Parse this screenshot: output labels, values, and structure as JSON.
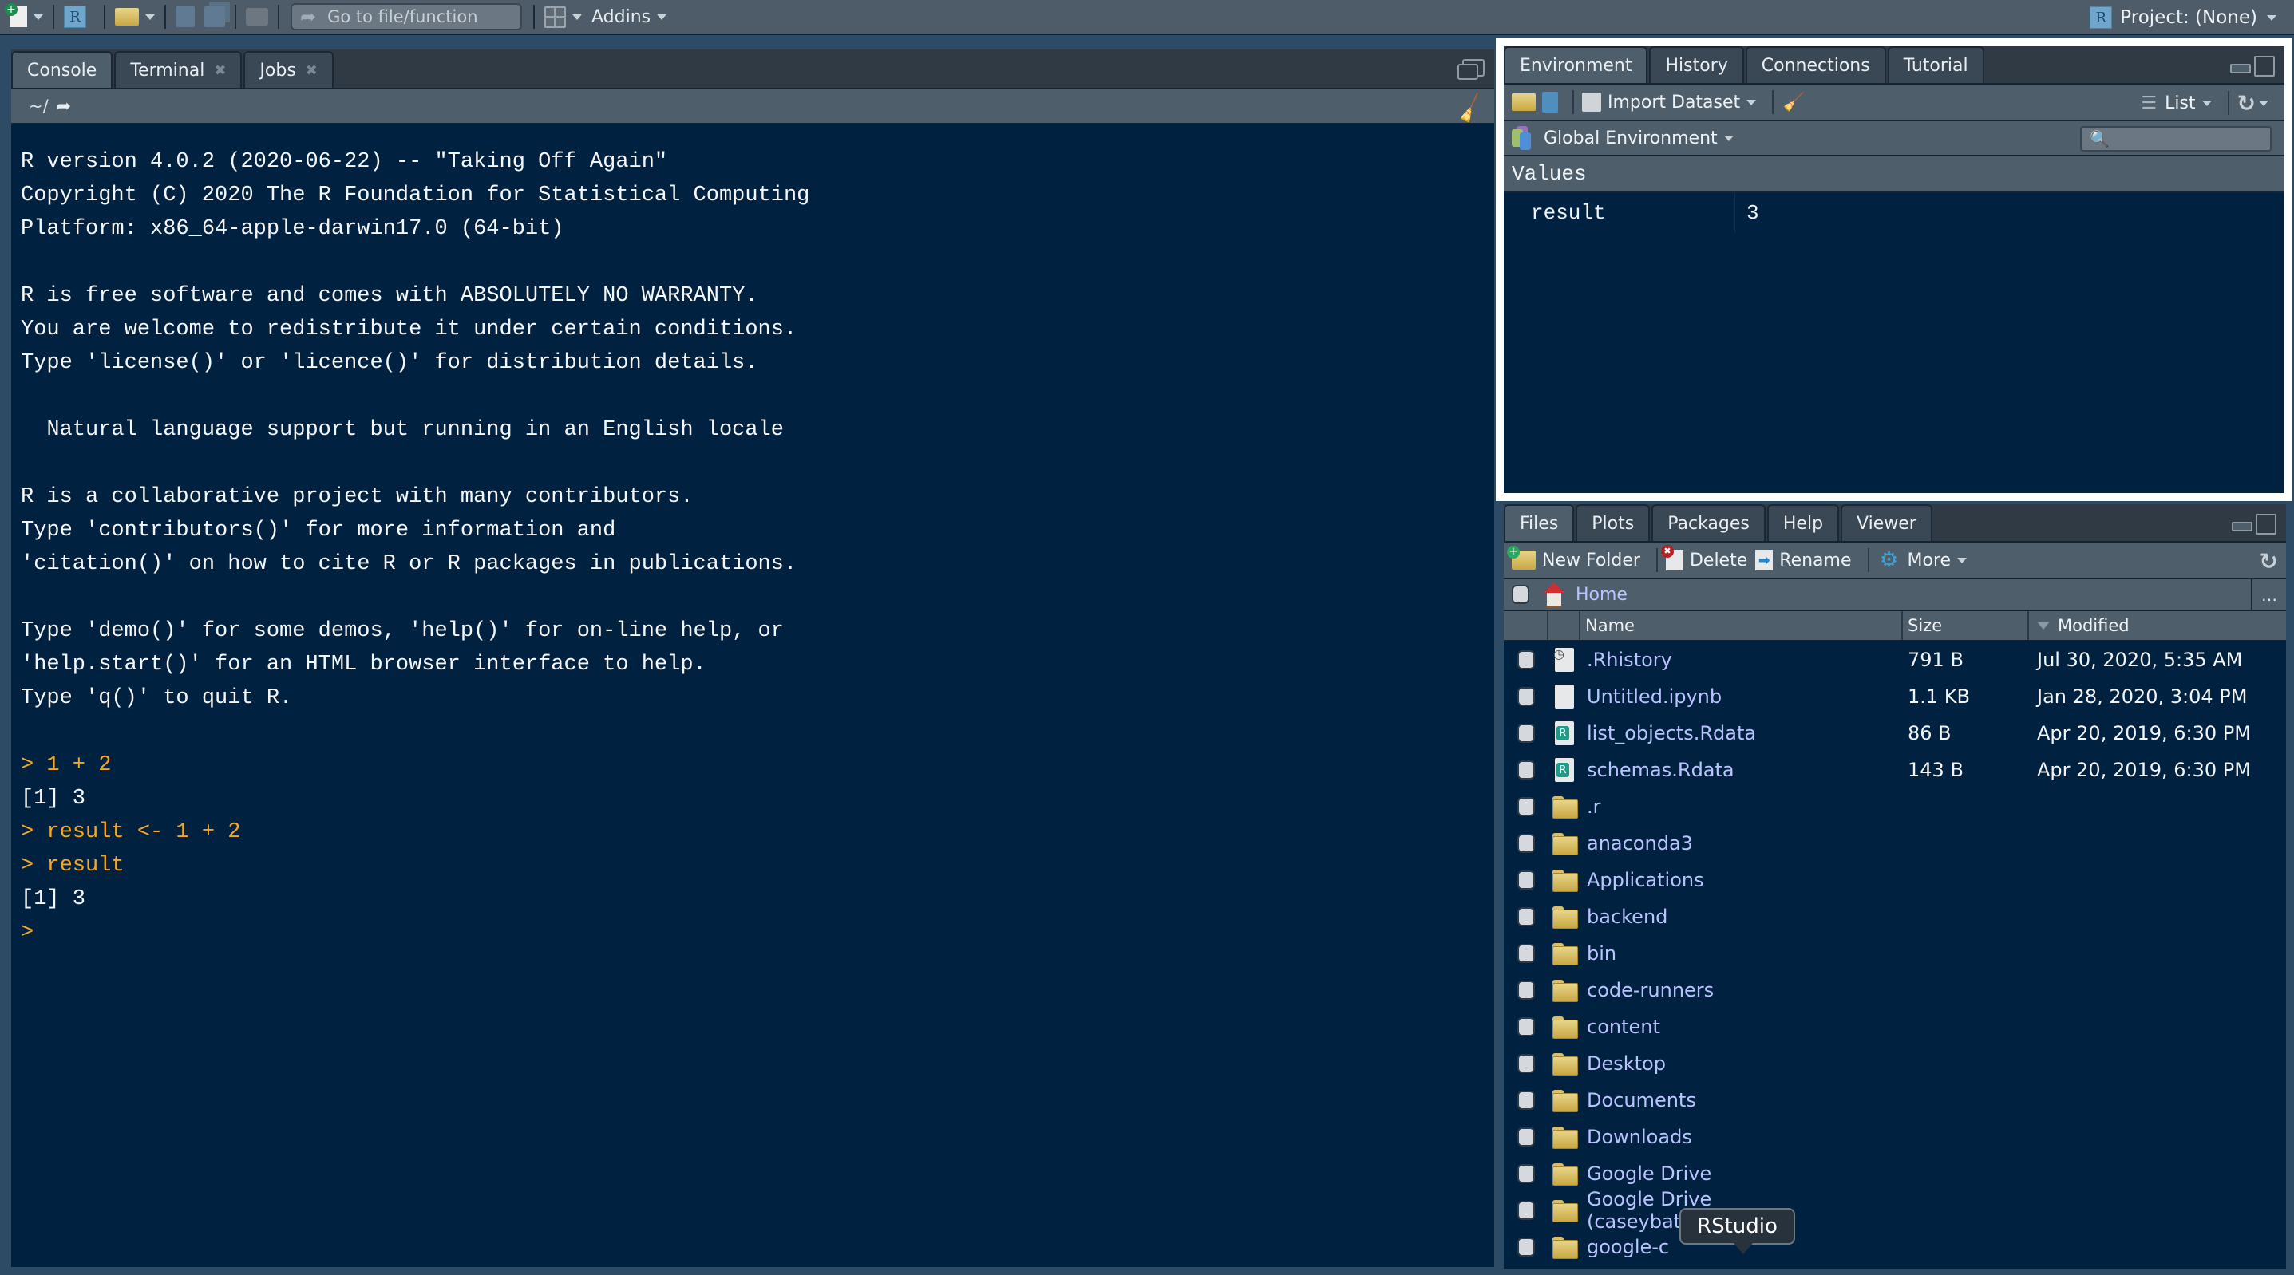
{
  "toolbar": {
    "goto_placeholder": "Go to file/function",
    "addins_label": "Addins",
    "project_label": "Project: (None)"
  },
  "left_pane": {
    "tabs": [
      {
        "label": "Console",
        "closable": false,
        "active": true
      },
      {
        "label": "Terminal",
        "closable": true,
        "active": false
      },
      {
        "label": "Jobs",
        "closable": true,
        "active": false
      }
    ],
    "working_dir": "~/",
    "console_lines": [
      {
        "text": "R version 4.0.2 (2020-06-22) -- \"Taking Off Again\"",
        "type": "output"
      },
      {
        "text": "Copyright (C) 2020 The R Foundation for Statistical Computing",
        "type": "output"
      },
      {
        "text": "Platform: x86_64-apple-darwin17.0 (64-bit)",
        "type": "output"
      },
      {
        "text": "",
        "type": "output"
      },
      {
        "text": "R is free software and comes with ABSOLUTELY NO WARRANTY.",
        "type": "output"
      },
      {
        "text": "You are welcome to redistribute it under certain conditions.",
        "type": "output"
      },
      {
        "text": "Type 'license()' or 'licence()' for distribution details.",
        "type": "output"
      },
      {
        "text": "",
        "type": "output"
      },
      {
        "text": "  Natural language support but running in an English locale",
        "type": "output"
      },
      {
        "text": "",
        "type": "output"
      },
      {
        "text": "R is a collaborative project with many contributors.",
        "type": "output"
      },
      {
        "text": "Type 'contributors()' for more information and",
        "type": "output"
      },
      {
        "text": "'citation()' on how to cite R or R packages in publications.",
        "type": "output"
      },
      {
        "text": "",
        "type": "output"
      },
      {
        "text": "Type 'demo()' for some demos, 'help()' for on-line help, or",
        "type": "output"
      },
      {
        "text": "'help.start()' for an HTML browser interface to help.",
        "type": "output"
      },
      {
        "text": "Type 'q()' to quit R.",
        "type": "output"
      },
      {
        "text": "",
        "type": "output"
      },
      {
        "text": "> 1 + 2",
        "type": "cmd"
      },
      {
        "text": "[1] 3",
        "type": "output"
      },
      {
        "text": "> result <- 1 + 2",
        "type": "cmd"
      },
      {
        "text": "> result",
        "type": "cmd"
      },
      {
        "text": "[1] 3",
        "type": "output"
      },
      {
        "text": ">",
        "type": "cmd"
      }
    ]
  },
  "env_pane": {
    "tabs": [
      {
        "label": "Environment",
        "active": true
      },
      {
        "label": "History",
        "active": false
      },
      {
        "label": "Connections",
        "active": false
      },
      {
        "label": "Tutorial",
        "active": false
      }
    ],
    "import_label": "Import Dataset",
    "view_mode": "List",
    "environment": "Global Environment",
    "search_placeholder": "",
    "section_header": "Values",
    "values": [
      {
        "name": "result",
        "value": "3"
      }
    ]
  },
  "files_pane": {
    "tabs": [
      {
        "label": "Files",
        "active": true
      },
      {
        "label": "Plots",
        "active": false
      },
      {
        "label": "Packages",
        "active": false
      },
      {
        "label": "Help",
        "active": false
      },
      {
        "label": "Viewer",
        "active": false
      }
    ],
    "new_folder_label": "New Folder",
    "delete_label": "Delete",
    "rename_label": "Rename",
    "more_label": "More",
    "path": "Home",
    "columns": {
      "name": "Name",
      "size": "Size",
      "modified": "Modified"
    },
    "files": [
      {
        "name": ".Rhistory",
        "size": "791 B",
        "modified": "Jul 30, 2020, 5:35 AM",
        "kind": "hist"
      },
      {
        "name": "Untitled.ipynb",
        "size": "1.1 KB",
        "modified": "Jan 28, 2020, 3:04 PM",
        "kind": "doc"
      },
      {
        "name": "list_objects.Rdata",
        "size": "86 B",
        "modified": "Apr 20, 2019, 6:30 PM",
        "kind": "rdata"
      },
      {
        "name": "schemas.Rdata",
        "size": "143 B",
        "modified": "Apr 20, 2019, 6:30 PM",
        "kind": "rdata"
      },
      {
        "name": ".r",
        "size": "",
        "modified": "",
        "kind": "folder"
      },
      {
        "name": "anaconda3",
        "size": "",
        "modified": "",
        "kind": "folder"
      },
      {
        "name": "Applications",
        "size": "",
        "modified": "",
        "kind": "folder"
      },
      {
        "name": "backend",
        "size": "",
        "modified": "",
        "kind": "folder"
      },
      {
        "name": "bin",
        "size": "",
        "modified": "",
        "kind": "folder"
      },
      {
        "name": "code-runners",
        "size": "",
        "modified": "",
        "kind": "folder"
      },
      {
        "name": "content",
        "size": "",
        "modified": "",
        "kind": "folder"
      },
      {
        "name": "Desktop",
        "size": "",
        "modified": "",
        "kind": "folder"
      },
      {
        "name": "Documents",
        "size": "",
        "modified": "",
        "kind": "folder"
      },
      {
        "name": "Downloads",
        "size": "",
        "modified": "",
        "kind": "folder"
      },
      {
        "name": "Google Drive",
        "size": "",
        "modified": "",
        "kind": "folder"
      },
      {
        "name": "Google Drive (caseybates@gmai...",
        "size": "",
        "modified": "",
        "kind": "folder"
      },
      {
        "name": "google-c",
        "size": "",
        "modified": "",
        "kind": "folder"
      }
    ]
  },
  "tooltip": {
    "text": "RStudio"
  },
  "colors": {
    "console_bg": "#002240",
    "command_text": "#f5a623",
    "toolbar_bg": "#4e5c69",
    "highlight_border": "#ffffff"
  }
}
